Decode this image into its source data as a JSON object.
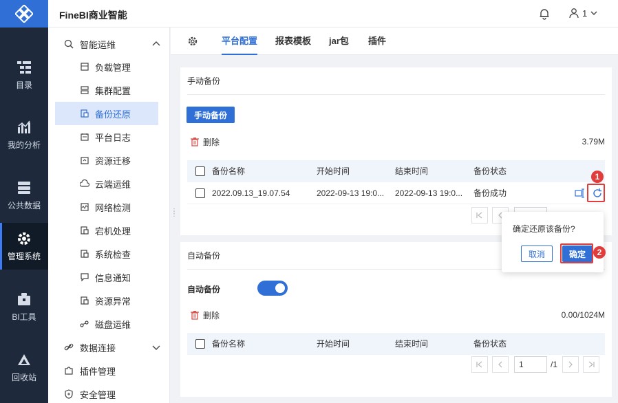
{
  "header": {
    "brand": "FineBI商业智能",
    "user_label": "1"
  },
  "leftnav": {
    "items": [
      {
        "label": "目录",
        "icon": "catalog-icon"
      },
      {
        "label": "我的分析",
        "icon": "chart-icon"
      },
      {
        "label": "公共数据",
        "icon": "database-icon"
      },
      {
        "label": "管理系统",
        "icon": "gear-icon"
      },
      {
        "label": "BI工具",
        "icon": "toolbox-icon"
      },
      {
        "label": "回收站",
        "icon": "recycle-icon"
      }
    ]
  },
  "sidebar": {
    "groups": [
      {
        "label": "智能运维",
        "icon": "ops-icon"
      },
      {
        "label": "数据连接",
        "icon": "link-icon"
      },
      {
        "label": "插件管理",
        "icon": "plugin-icon"
      },
      {
        "label": "安全管理",
        "icon": "shield-icon"
      }
    ],
    "items": [
      {
        "label": "负载管理",
        "icon": "load-icon"
      },
      {
        "label": "集群配置",
        "icon": "cluster-icon"
      },
      {
        "label": "备份还原",
        "icon": "backup-icon"
      },
      {
        "label": "平台日志",
        "icon": "log-icon"
      },
      {
        "label": "资源迁移",
        "icon": "migrate-icon"
      },
      {
        "label": "云端运维",
        "icon": "cloud-icon"
      },
      {
        "label": "网络检测",
        "icon": "network-icon"
      },
      {
        "label": "宕机处理",
        "icon": "crash-icon"
      },
      {
        "label": "系统检查",
        "icon": "check-icon"
      },
      {
        "label": "信息通知",
        "icon": "message-icon"
      },
      {
        "label": "资源异常",
        "icon": "warn-icon"
      },
      {
        "label": "磁盘运维",
        "icon": "disk-icon"
      }
    ],
    "active_item": "备份还原"
  },
  "tabs": [
    {
      "label": "平台配置"
    },
    {
      "label": "报表模板"
    },
    {
      "label": "jar包"
    },
    {
      "label": "插件"
    }
  ],
  "manual": {
    "title": "手动备份",
    "button": "手动备份",
    "delete_label": "删除",
    "size": "3.79M",
    "columns": [
      "备份名称",
      "开始时间",
      "结束时间",
      "备份状态"
    ],
    "rows": [
      {
        "name": "2022.09.13_19.07.54",
        "start": "2022-09-13 19:0...",
        "end": "2022-09-13 19:0...",
        "status": "备份成功"
      }
    ]
  },
  "auto": {
    "title": "自动备份",
    "toggle_label": "自动备份",
    "delete_label": "删除",
    "size": "0.00/1024M",
    "columns": [
      "备份名称",
      "开始时间",
      "结束时间",
      "备份状态"
    ],
    "page_value": "1",
    "page_total": "/1"
  },
  "popover": {
    "message": "确定还原该备份?",
    "cancel": "取消",
    "ok": "确定"
  },
  "markers": [
    "1",
    "2"
  ],
  "colors": {
    "accent": "#2f6fd6",
    "nav_bg": "#1e2a3c",
    "highlight": "#e23b3b"
  }
}
